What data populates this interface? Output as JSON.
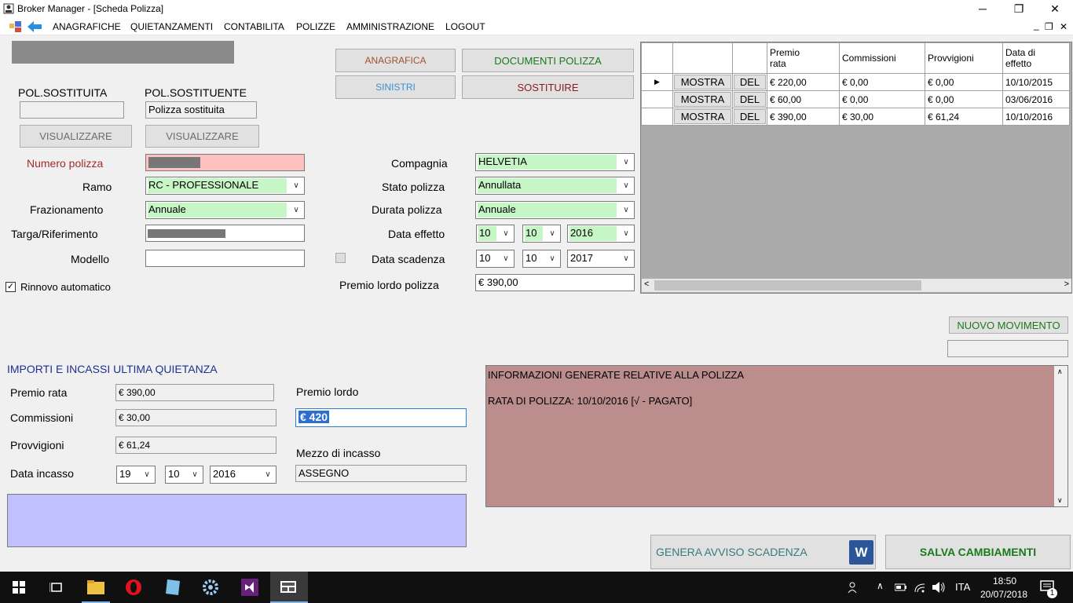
{
  "window": {
    "title": "Broker Manager - [Scheda Polizza]",
    "minimize_glyph": "─",
    "restore_glyph": "❐",
    "close_glyph": "✕"
  },
  "menu": {
    "items": [
      "ANAGRAFICHE",
      "QUIETANZAMENTI",
      "CONTABILITA",
      "POLIZZE",
      "AMMINISTRAZIONE",
      "LOGOUT"
    ],
    "mdi_minimize": "_",
    "mdi_restore": "❐",
    "mdi_close": "✕"
  },
  "top_buttons": {
    "anagrafica": "ANAGRAFICA",
    "documenti": "DOCUMENTI POLIZZA",
    "sinistri": "SINISTRI",
    "sostituire": "SOSTITUIRE"
  },
  "colors": {
    "anagrafica": "#a0522d",
    "documenti": "#1a7a1a",
    "sinistri": "#3a8fd0",
    "sostituire": "#8b1a1a",
    "numero_polizza": "#a52a2a",
    "section_title": "#1f2f8f",
    "genera": "#3a7a7a",
    "salva": "#1a7a1a"
  },
  "sostituzione": {
    "pol_sostituita_label": "POL.SOSTITUITA",
    "pol_sostituente_label": "POL.SOSTITUENTE",
    "pol_sostituita_value": "",
    "pol_sostituente_value": "Polizza sostituita",
    "visualizzare_1": "VISUALIZZARE",
    "visualizzare_2": "VISUALIZZARE"
  },
  "form": {
    "numero_polizza_label": "Numero polizza",
    "ramo_label": "Ramo",
    "ramo_value": "RC - PROFESSIONALE",
    "frazionamento_label": "Frazionamento",
    "frazionamento_value": "Annuale",
    "targa_label": "Targa/Riferimento",
    "modello_label": "Modello",
    "modello_value": "",
    "rinnovo_label": "Rinnovo automatico",
    "rinnovo_checked": true,
    "compagnia_label": "Compagnia",
    "compagnia_value": "HELVETIA",
    "stato_label": "Stato polizza",
    "stato_value": "Annullata",
    "durata_label": "Durata polizza",
    "durata_value": "Annuale",
    "data_effetto_label": "Data effetto",
    "effetto_giorno": "10",
    "effetto_mese": "10",
    "effetto_anno": "2016",
    "data_scadenza_label": "Data scadenza",
    "scadenza_giorno": "10",
    "scadenza_mese": "10",
    "scadenza_anno": "2017",
    "premio_lordo_polizza_label": "Premio lordo polizza",
    "premio_lordo_polizza_value": "€ 390,00"
  },
  "grid": {
    "headers": [
      "",
      "",
      "",
      "Premio\nrata",
      "Commissioni",
      "Provvigioni",
      "Data di\neffetto"
    ],
    "rows": [
      {
        "mostra": "MOSTRA",
        "del": "DEL",
        "premio": "€ 220,00",
        "commissioni": "€ 0,00",
        "provvigioni": "€ 0,00",
        "data": "10/10/2015"
      },
      {
        "mostra": "MOSTRA",
        "del": "DEL",
        "premio": "€ 60,00",
        "commissioni": "€ 0,00",
        "provvigioni": "€ 0,00",
        "data": "03/06/2016"
      },
      {
        "mostra": "MOSTRA",
        "del": "DEL",
        "premio": "€ 390,00",
        "commissioni": "€ 30,00",
        "provvigioni": "€ 61,24",
        "data": "10/10/2016"
      }
    ],
    "scroll_left": "<",
    "scroll_right": ">"
  },
  "nuovo_movimento": "NUOVO MOVIMENTO",
  "quietanza": {
    "title": "IMPORTI E INCASSI ULTIMA QUIETANZA",
    "premio_rata_label": "Premio rata",
    "premio_rata_value": "€ 390,00",
    "commissioni_label": "Commissioni",
    "commissioni_value": "€ 30,00",
    "provvigioni_label": "Provvigioni",
    "provvigioni_value": "€ 61,24",
    "data_incasso_label": "Data incasso",
    "incasso_giorno": "19",
    "incasso_mese": "10",
    "incasso_anno": "2016",
    "premio_lordo_label": "Premio lordo",
    "premio_lordo_value": "€ 420",
    "mezzo_label": "Mezzo di incasso",
    "mezzo_value": "ASSEGNO"
  },
  "info": {
    "line1": "INFORMAZIONI GENERATE RELATIVE ALLA POLIZZA",
    "line2": "RATA DI POLIZZA: 10/10/2016  [√ - PAGATO]"
  },
  "actions": {
    "genera": "GENERA AVVISO SCADENZA",
    "word_letter": "W",
    "salva": "SALVA CAMBIAMENTI"
  },
  "taskbar": {
    "lang": "ITA",
    "time": "18:50",
    "date": "20/07/2018",
    "notifications": "1"
  }
}
